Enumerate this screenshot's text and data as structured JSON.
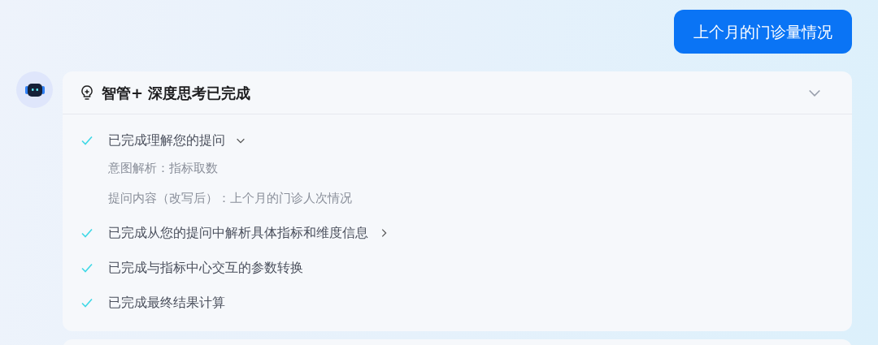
{
  "user_message": "上个月的门诊量情况",
  "thinking": {
    "title": "智管+ 深度思考已完成",
    "expanded": true,
    "steps": [
      {
        "label": "已完成理解您的提问",
        "done": true,
        "kind": "expandable",
        "expanded": true,
        "details": [
          "意图解析：指标取数",
          "提问内容（改写后）：上个月的门诊人次情况"
        ]
      },
      {
        "label": "已完成从您的提问中解析具体指标和维度信息",
        "done": true,
        "kind": "expandable",
        "expanded": false
      },
      {
        "label": "已完成与指标中心交互的参数转换",
        "done": true,
        "kind": "plain"
      },
      {
        "label": "已完成最终结果计算",
        "done": true,
        "kind": "plain"
      }
    ]
  }
}
